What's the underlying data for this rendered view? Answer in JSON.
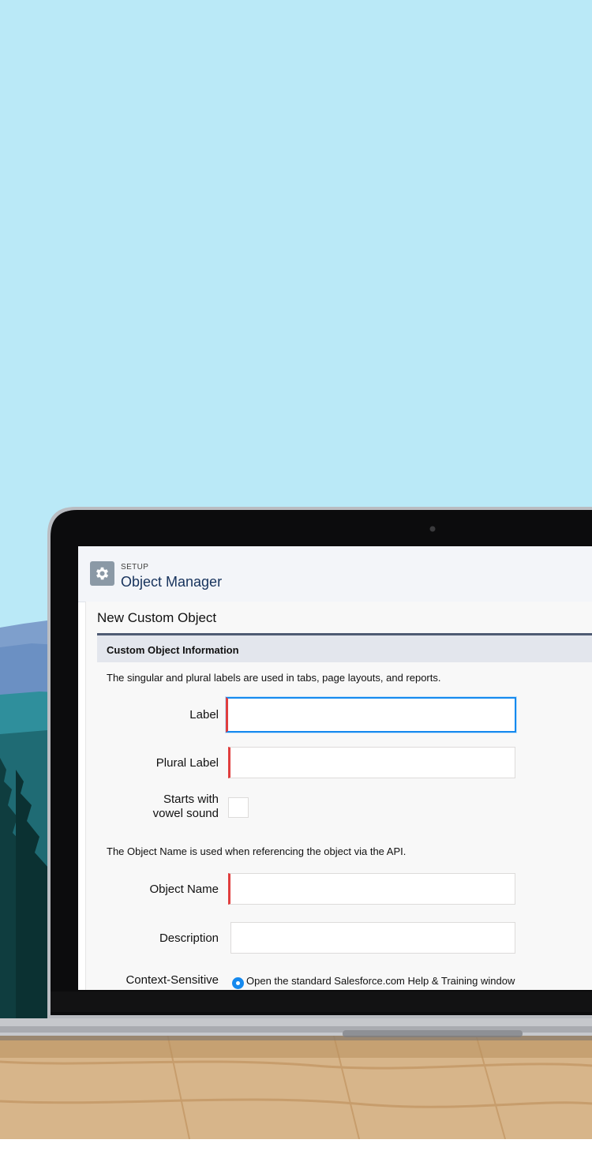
{
  "header": {
    "section_label": "SETUP",
    "title": "Object Manager",
    "icon": "gear-icon"
  },
  "page": {
    "title": "New Custom Object"
  },
  "section": {
    "title": "Custom Object Information",
    "labels_note": "The singular and plural labels are used in tabs, page layouts, and reports.",
    "api_note": "The Object Name is used when referencing the object via the API."
  },
  "fields": {
    "label": {
      "label": "Label",
      "value": "",
      "required": true,
      "focused": true
    },
    "plural_label": {
      "label": "Plural Label",
      "value": "",
      "required": true
    },
    "vowel_sound": {
      "label_line1": "Starts with",
      "label_line2": "vowel sound",
      "checked": false
    },
    "object_name": {
      "label": "Object Name",
      "value": "",
      "required": true
    },
    "description": {
      "label": "Description",
      "value": ""
    },
    "help": {
      "label_line1": "Context-Sensitive",
      "option": "Open the standard Salesforce.com Help & Training window",
      "selected": true
    }
  },
  "colors": {
    "sky": "#bae9f7",
    "accent": "#1589ee",
    "required": "#e03e3e",
    "section_rule": "#4e5b73"
  }
}
